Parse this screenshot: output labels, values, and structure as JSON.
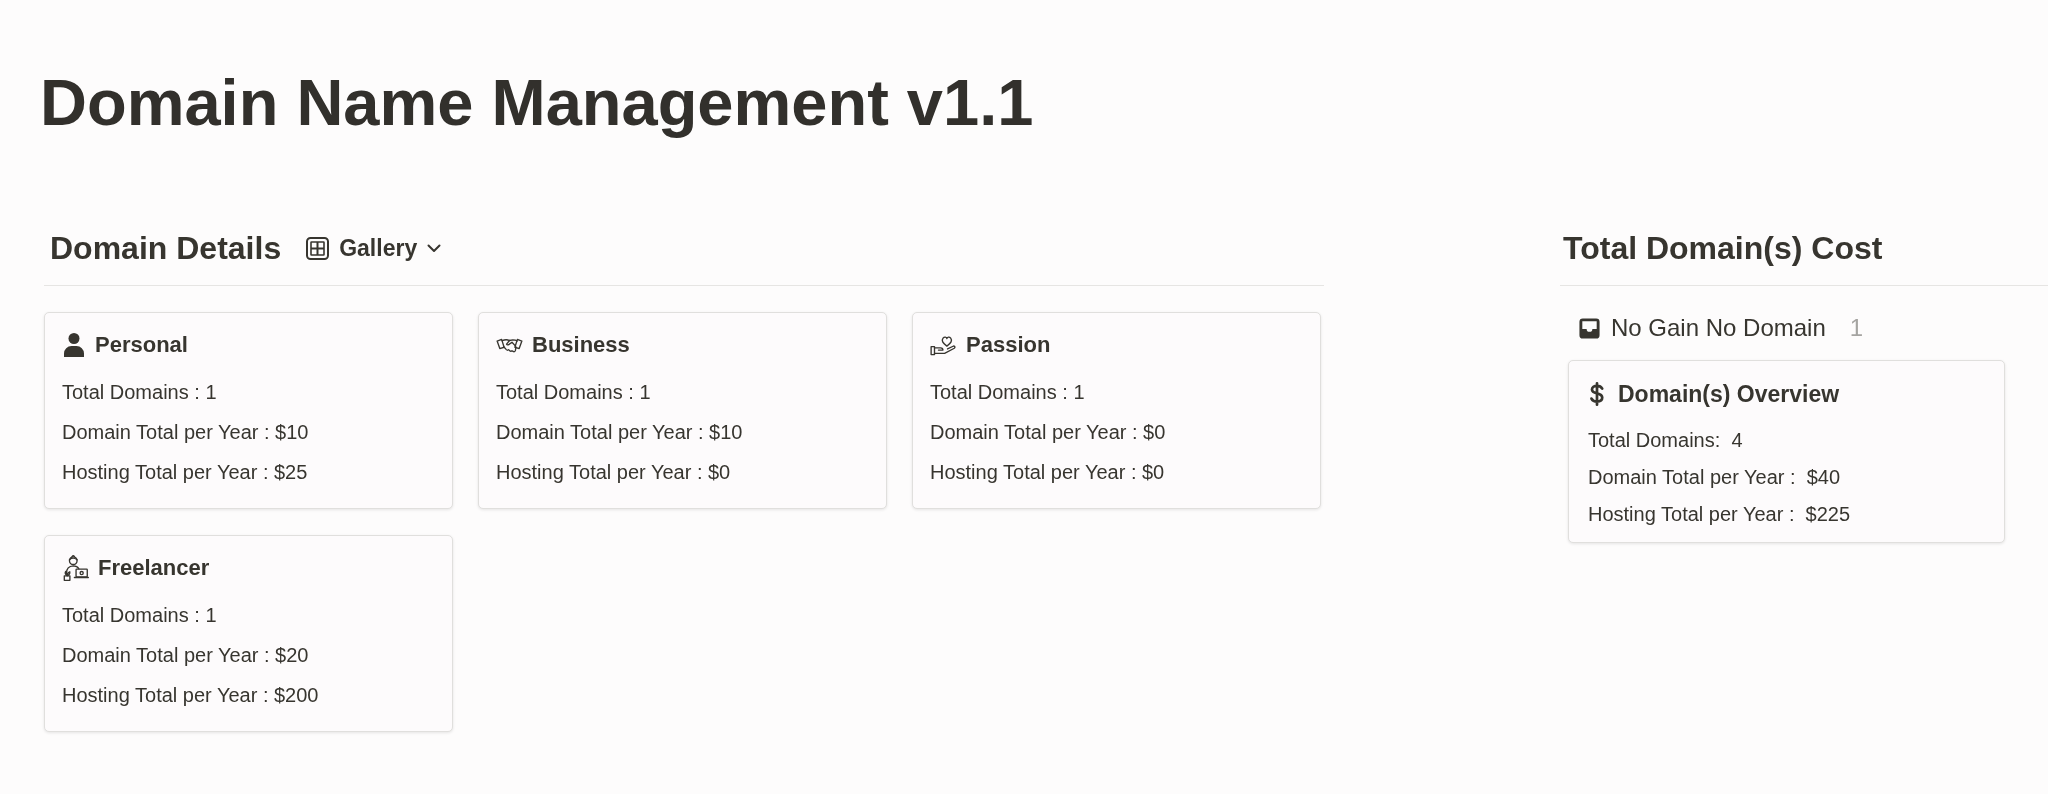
{
  "page": {
    "title": "Domain Name Management v1.1"
  },
  "domain_details": {
    "title": "Domain Details",
    "view": {
      "label": "Gallery"
    },
    "cards": [
      {
        "kind": "person",
        "title": "Personal",
        "lines": [
          "Total Domains : 1",
          "Domain Total per Year : $10",
          "Hosting Total per Year : $25"
        ]
      },
      {
        "kind": "handshake",
        "title": "Business",
        "lines": [
          "Total Domains : 1",
          "Domain Total per Year : $10",
          "Hosting Total per Year : $0"
        ]
      },
      {
        "kind": "care",
        "title": "Passion",
        "lines": [
          "Total Domains : 1",
          "Domain Total per Year : $0",
          "Hosting Total per Year : $0"
        ]
      },
      {
        "kind": "worker",
        "title": "Freelancer",
        "lines": [
          "Total Domains : 1",
          "Domain Total per Year : $20",
          "Hosting Total per Year : $200"
        ]
      }
    ]
  },
  "total_cost": {
    "title": "Total Domain(s) Cost",
    "group": {
      "label": "No Gain No Domain",
      "count": "1"
    },
    "card": {
      "title": "Domain(s) Overview",
      "lines": [
        "Total Domains:  4",
        "Domain Total per Year :  $40",
        "Hosting Total per Year :  $225"
      ]
    }
  }
}
